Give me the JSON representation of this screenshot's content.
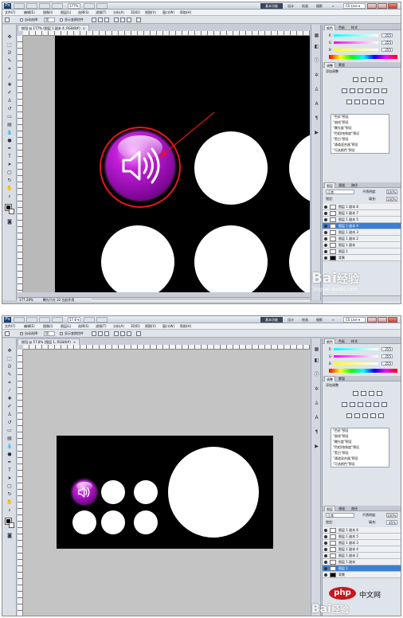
{
  "colors": {
    "canvas": "#000000",
    "button_purple": "#a410c0",
    "highlight": "#e8141c",
    "layer_selected": "#3b7fd6",
    "php_red": "#c7161d"
  },
  "app": {
    "logo": "Ps",
    "workspace_active": "基本功能",
    "workspaces": [
      "设计",
      "绘画",
      "摄影"
    ],
    "more": "»",
    "cs_live": "CS Live ▾"
  },
  "menu": [
    "文件(F)",
    "编辑(E)",
    "图像(I)",
    "图层(L)",
    "选择(S)",
    "滤镜(T)",
    "分析(A)",
    "3D(D)",
    "视图(V)",
    "窗口(W)",
    "帮助(H)"
  ],
  "shot1": {
    "zoom": "177% ▾",
    "doc_tab": "按钮 @ 177% (图层 1 副本 4, RGB/8#)",
    "status_zoom": "177.28%",
    "status_info": "曝光只在 32 位起作用",
    "options": {
      "auto_label": "自动选择:",
      "auto_value": "组",
      "transform_label": "显示变换控件"
    }
  },
  "shot2": {
    "zoom": "57.8 ▾",
    "doc_tab": "按钮 @ 57.8% (图层 1, RGB/8#)",
    "options": {
      "auto_label": "自动选择:",
      "auto_value": "组",
      "transform_label": "显示变换控件"
    }
  },
  "panels": {
    "color_tabs": [
      "颜色",
      "色板",
      "样式"
    ],
    "rgb": [
      {
        "channel": "R",
        "value": "255"
      },
      {
        "channel": "G",
        "value": "255"
      },
      {
        "channel": "B",
        "value": "255"
      }
    ],
    "adjust_tabs": [
      "调整",
      "蒙版"
    ],
    "adjust_title": "添加调整",
    "presets": [
      "\"色阶\"预设",
      "\"曲线\"预设",
      "\"曝光度\"预设",
      "\"色相/饱和度\"预设",
      "\"黑白\"预设",
      "\"通道混合器\"预设",
      "\"可选颜色\"预设"
    ],
    "layer_tabs": [
      "图层",
      "通道",
      "路径"
    ],
    "blend_mode": "正常",
    "opacity_label": "不透明度:",
    "opacity": "100%",
    "lock_label": "锁定:",
    "fill_label": "填充:",
    "fill1": "100%",
    "fill2": "85%",
    "layers1": [
      "图层 1 副本 8",
      "图层 1 副本 7",
      "图层 1 副本 5",
      "图层 1 副本 4",
      "图层 1 副本 3",
      "图层 1 副本 2",
      "图层 1 副本",
      "图层 1",
      "背景"
    ],
    "layers2": [
      "图层 1 副本 6",
      "图层 1 副本 5",
      "图层 1 副本 3",
      "图层 1 副本 4",
      "图层 1 副本 2",
      "图层 1 副本",
      "图层 1",
      "背景"
    ]
  },
  "watermark": {
    "brand": "Bai",
    "brand_suffix": "经验",
    "url": "jingyan.baidu.com"
  },
  "php": {
    "logo": "php",
    "text": "中文网"
  }
}
